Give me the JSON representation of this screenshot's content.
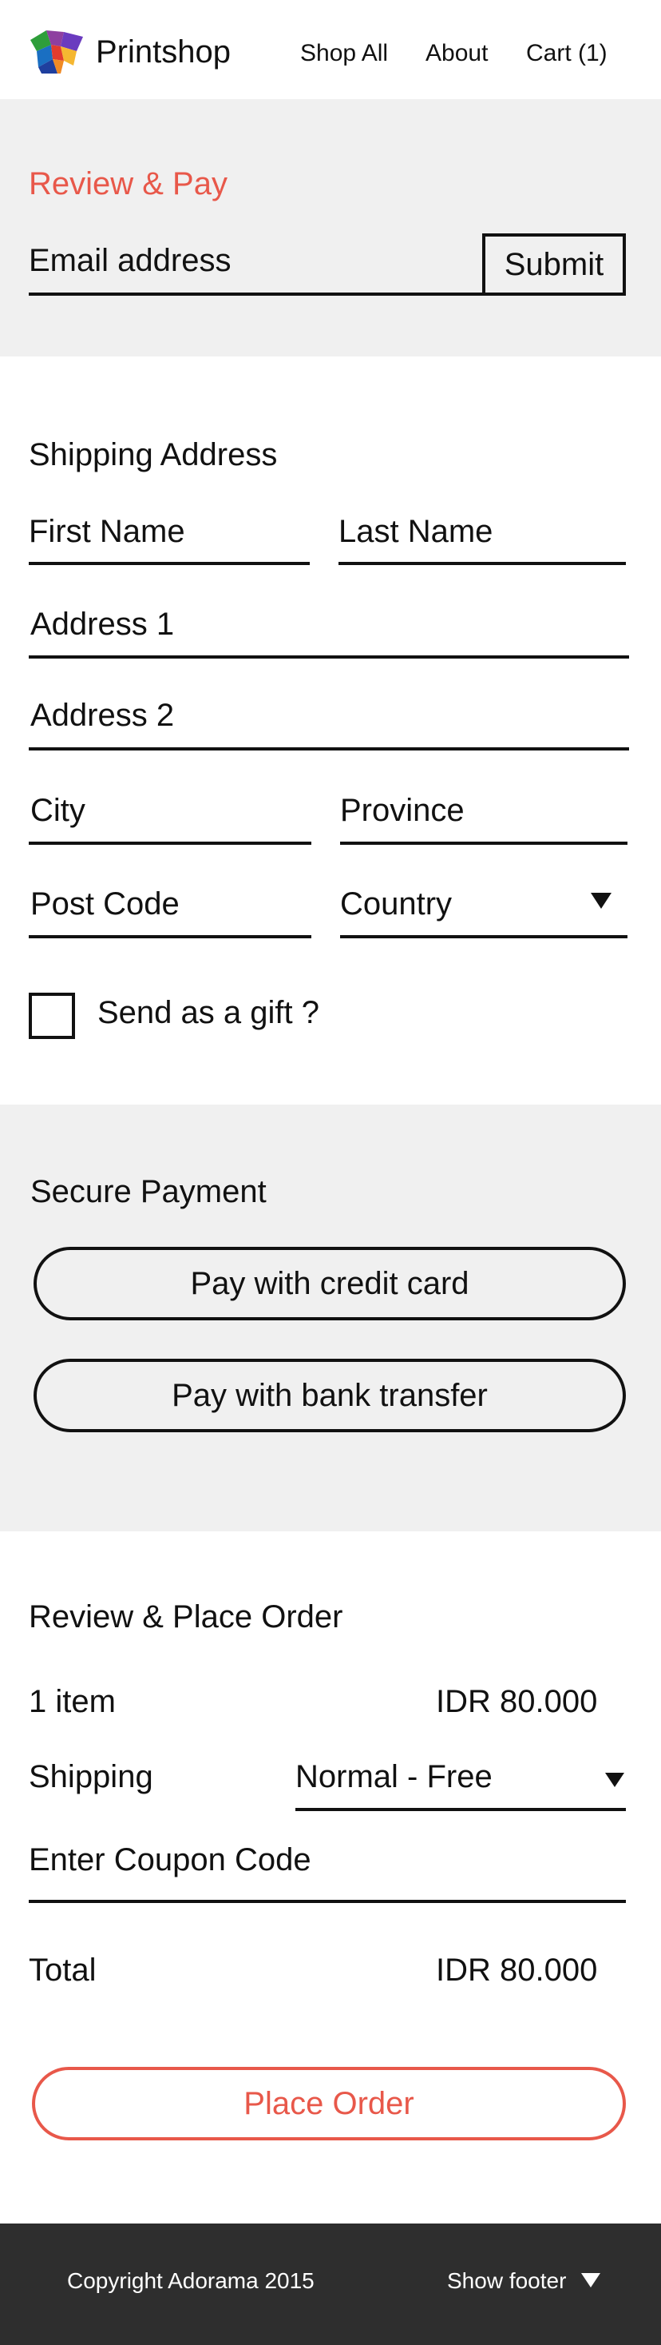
{
  "header": {
    "brand": "Printshop",
    "nav": [
      "Shop All",
      "About",
      "Cart (1)"
    ]
  },
  "review_pay": {
    "title": "Review & Pay",
    "email_placeholder": "Email address",
    "submit_label": "Submit"
  },
  "shipping": {
    "title": "Shipping Address",
    "first_name": "First Name",
    "last_name": "Last Name",
    "address1": "Address 1",
    "address2": "Address 2",
    "city": "City",
    "province": "Province",
    "post_code": "Post Code",
    "country": "Country",
    "gift_label": "Send as a gift ?"
  },
  "payment": {
    "title": "Secure Payment",
    "credit_card": "Pay with credit card",
    "bank_transfer": "Pay with bank transfer"
  },
  "order": {
    "title": "Review & Place Order",
    "items_label": "1 item",
    "items_value": "IDR 80.000",
    "shipping_label": "Shipping",
    "shipping_option": "Normal - Free",
    "coupon_placeholder": "Enter Coupon Code",
    "total_label": "Total",
    "total_value": "IDR 80.000",
    "place_order": "Place Order"
  },
  "footer": {
    "copyright": "Copyright Adorama 2015",
    "show_footer": "Show footer"
  },
  "colors": {
    "accent": "#e8584a",
    "band": "#f0f0f0",
    "footer": "#2e2e2e"
  }
}
